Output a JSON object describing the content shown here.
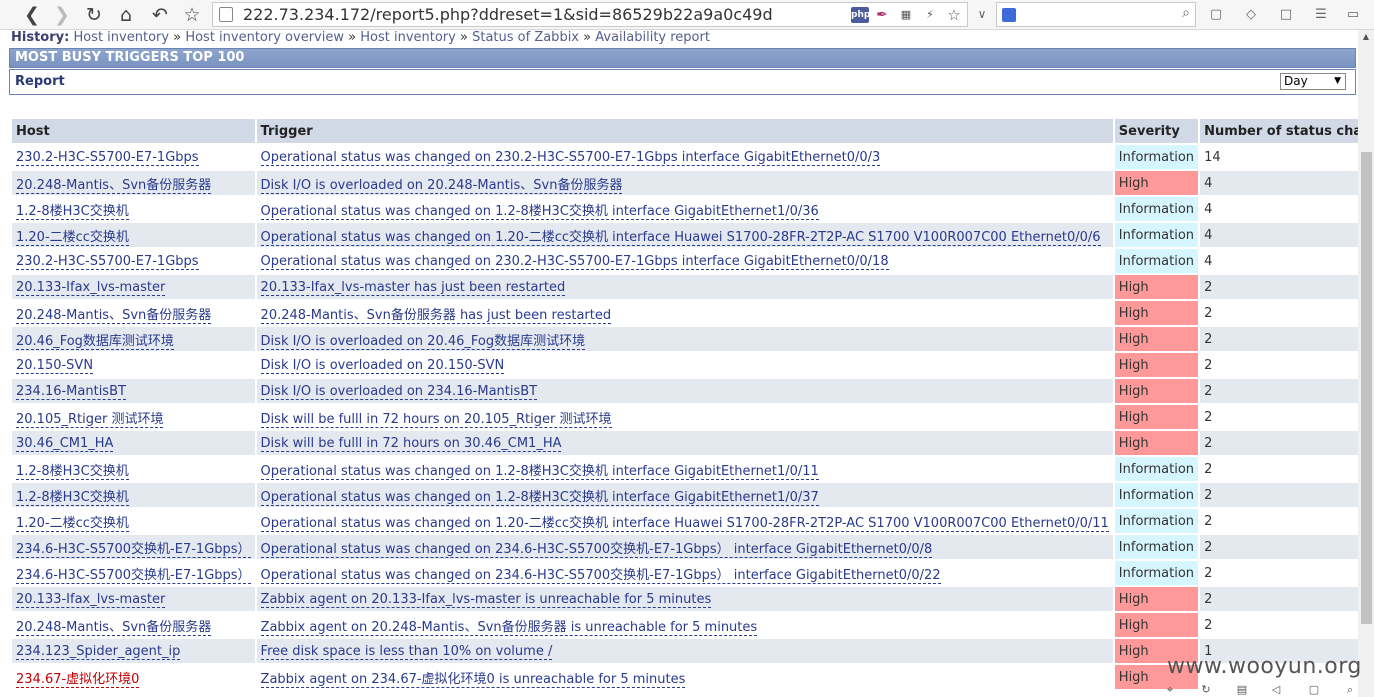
{
  "browser": {
    "url": "222.73.234.172/report5.php?ddreset=1&sid=86529b22a9a0c49d",
    "ext_php": "php"
  },
  "history": {
    "label": "History:",
    "items": [
      "Host inventory",
      "Host inventory overview",
      "Host inventory",
      "Status of Zabbix",
      "Availability report"
    ],
    "separator": "»"
  },
  "title": "MOST BUSY TRIGGERS TOP 100",
  "report": {
    "label": "Report",
    "period": "Day"
  },
  "table": {
    "headers": [
      "Host",
      "Trigger",
      "Severity",
      "Number of status changes"
    ],
    "rows": [
      {
        "host": "230.2-H3C-S5700-E7-1Gbps",
        "trigger": "Operational status was changed on 230.2-H3C-S5700-E7-1Gbps interface GigabitEthernet0/0/3",
        "severity": "Information",
        "count": "14"
      },
      {
        "host": "20.248-Mantis、Svn备份服务器",
        "trigger": "Disk I/O is overloaded on 20.248-Mantis、Svn备份服务器",
        "severity": "High",
        "count": "4"
      },
      {
        "host": "1.2-8楼H3C交换机",
        "trigger": "Operational status was changed on 1.2-8楼H3C交换机 interface GigabitEthernet1/0/36",
        "severity": "Information",
        "count": "4"
      },
      {
        "host": "1.20-二楼cc交换机",
        "trigger": "Operational status was changed on 1.20-二楼cc交换机 interface Huawei S1700-28FR-2T2P-AC S1700 V100R007C00 Ethernet0/0/6",
        "severity": "Information",
        "count": "4"
      },
      {
        "host": "230.2-H3C-S5700-E7-1Gbps",
        "trigger": "Operational status was changed on 230.2-H3C-S5700-E7-1Gbps interface GigabitEthernet0/0/18",
        "severity": "Information",
        "count": "4"
      },
      {
        "host": "20.133-Ifax_lvs-master",
        "trigger": "20.133-Ifax_lvs-master has just been restarted",
        "severity": "High",
        "count": "2"
      },
      {
        "host": "20.248-Mantis、Svn备份服务器",
        "trigger": "20.248-Mantis、Svn备份服务器 has just been restarted",
        "severity": "High",
        "count": "2"
      },
      {
        "host": "20.46_Fog数据库测试环境",
        "trigger": "Disk I/O is overloaded on 20.46_Fog数据库测试环境",
        "severity": "High",
        "count": "2"
      },
      {
        "host": "20.150-SVN",
        "trigger": "Disk I/O is overloaded on 20.150-SVN",
        "severity": "High",
        "count": "2"
      },
      {
        "host": "234.16-MantisBT",
        "trigger": "Disk I/O is overloaded on 234.16-MantisBT",
        "severity": "High",
        "count": "2"
      },
      {
        "host": "20.105_Rtiger 测试环境",
        "trigger": "Disk will be fulll in 72 hours on 20.105_Rtiger 测试环境",
        "severity": "High",
        "count": "2"
      },
      {
        "host": "30.46_CM1_HA",
        "trigger": "Disk will be fulll in 72 hours on 30.46_CM1_HA",
        "severity": "High",
        "count": "2"
      },
      {
        "host": "1.2-8楼H3C交换机",
        "trigger": "Operational status was changed on 1.2-8楼H3C交换机 interface GigabitEthernet1/0/11",
        "severity": "Information",
        "count": "2"
      },
      {
        "host": "1.2-8楼H3C交换机",
        "trigger": "Operational status was changed on 1.2-8楼H3C交换机 interface GigabitEthernet1/0/37",
        "severity": "Information",
        "count": "2"
      },
      {
        "host": "1.20-二楼cc交换机",
        "trigger": "Operational status was changed on 1.20-二楼cc交换机 interface Huawei S1700-28FR-2T2P-AC S1700 V100R007C00 Ethernet0/0/11",
        "severity": "Information",
        "count": "2"
      },
      {
        "host": "234.6-H3C-S5700交换机-E7-1Gbps）",
        "trigger": "Operational status was changed on 234.6-H3C-S5700交换机-E7-1Gbps） interface GigabitEthernet0/0/8",
        "severity": "Information",
        "count": "2"
      },
      {
        "host": "234.6-H3C-S5700交换机-E7-1Gbps）",
        "trigger": "Operational status was changed on 234.6-H3C-S5700交换机-E7-1Gbps） interface GigabitEthernet0/0/22",
        "severity": "Information",
        "count": "2"
      },
      {
        "host": "20.133-Ifax_lvs-master",
        "trigger": "Zabbix agent on 20.133-Ifax_lvs-master is unreachable for 5 minutes",
        "severity": "High",
        "count": "2"
      },
      {
        "host": "20.248-Mantis、Svn备份服务器",
        "trigger": "Zabbix agent on 20.248-Mantis、Svn备份服务器 is unreachable for 5 minutes",
        "severity": "High",
        "count": "2"
      },
      {
        "host": "234.123_Spider_agent_ip",
        "trigger": "Free disk space is less than 10% on volume /",
        "severity": "High",
        "count": "1"
      },
      {
        "host": "234.67-虚拟化环境0",
        "trigger": "Zabbix agent on 234.67-虚拟化环境0 is unreachable for 5 minutes",
        "severity": "High",
        "count": "",
        "host_color": "#c00000"
      }
    ]
  },
  "watermark": "www.wooyun.org"
}
